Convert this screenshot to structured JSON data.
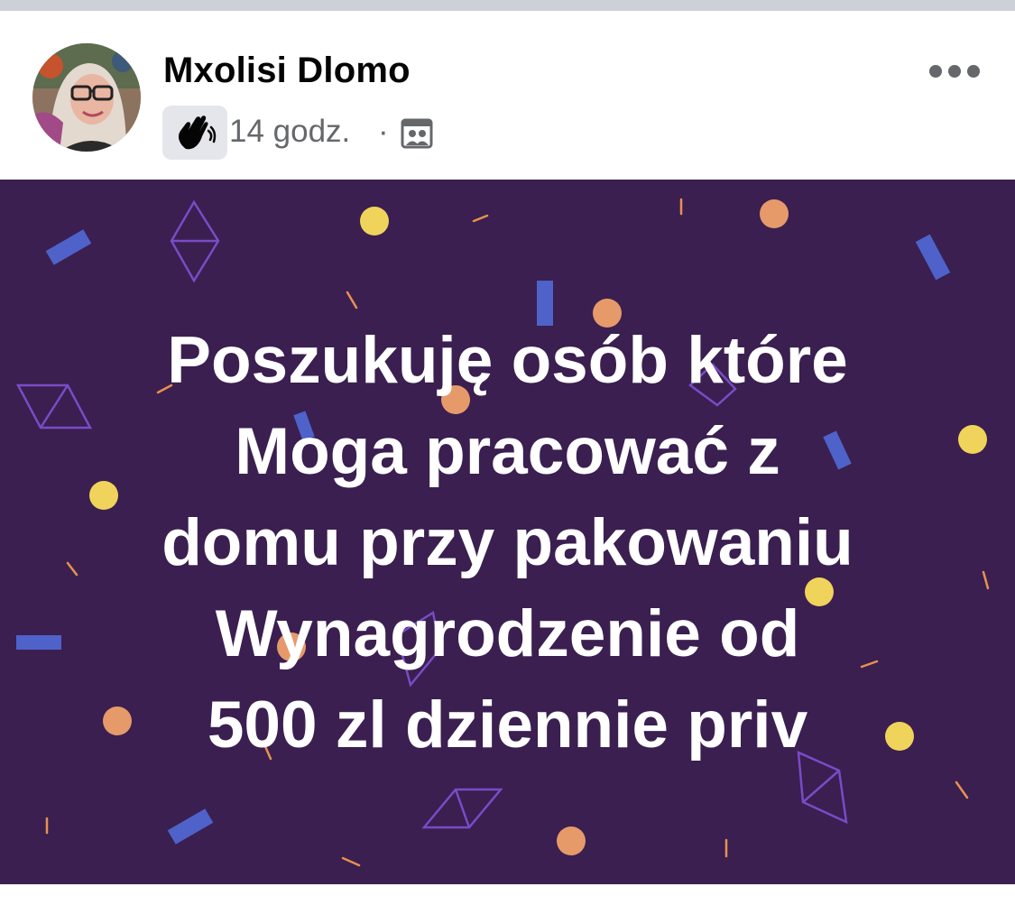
{
  "post": {
    "author_name": "Mxolisi Dlomo",
    "timestamp": "14 godz.",
    "separator": "·",
    "badge_icon": "waving-hand-icon",
    "audience_icon": "group-icon",
    "menu_icon": "more-horizontal-icon",
    "body_text": "Poszukuję osób które\nMoga pracować z\ndomu przy pakowaniu\nWynagrodzenie od\n500 zl dziennie priv",
    "colors": {
      "background": "#3a1f50",
      "text": "#ffffff",
      "name": "#050505",
      "meta": "#65676b",
      "badge_bg": "#e4e6eb"
    }
  }
}
